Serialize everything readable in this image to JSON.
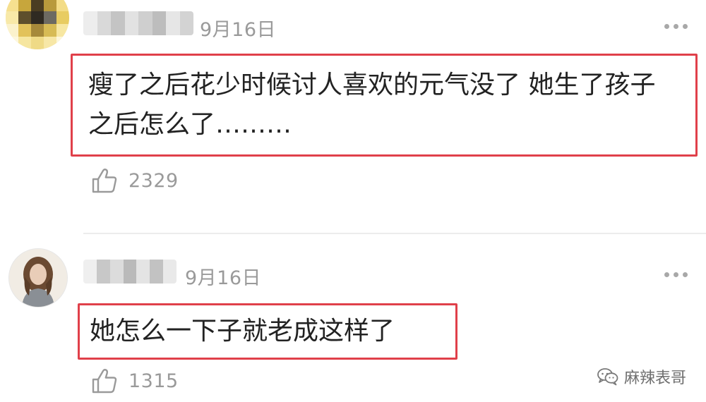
{
  "comments": [
    {
      "date": "9月16日",
      "text": "瘦了之后花少时候讨人喜欢的元气没了 她生了孩子之后怎么了………",
      "likes": "2329"
    },
    {
      "date": "9月16日",
      "text": "她怎么一下子就老成这样了",
      "likes": "1315"
    }
  ],
  "watermark": {
    "text": "麻辣表哥",
    "icon": "wechat-icon"
  },
  "icons": {
    "like": "thumbs-up-icon",
    "more": "more-dots-icon"
  },
  "colors": {
    "highlight_border": "#e0404a",
    "meta_text": "#9a9a9a",
    "body_text": "#222222"
  }
}
